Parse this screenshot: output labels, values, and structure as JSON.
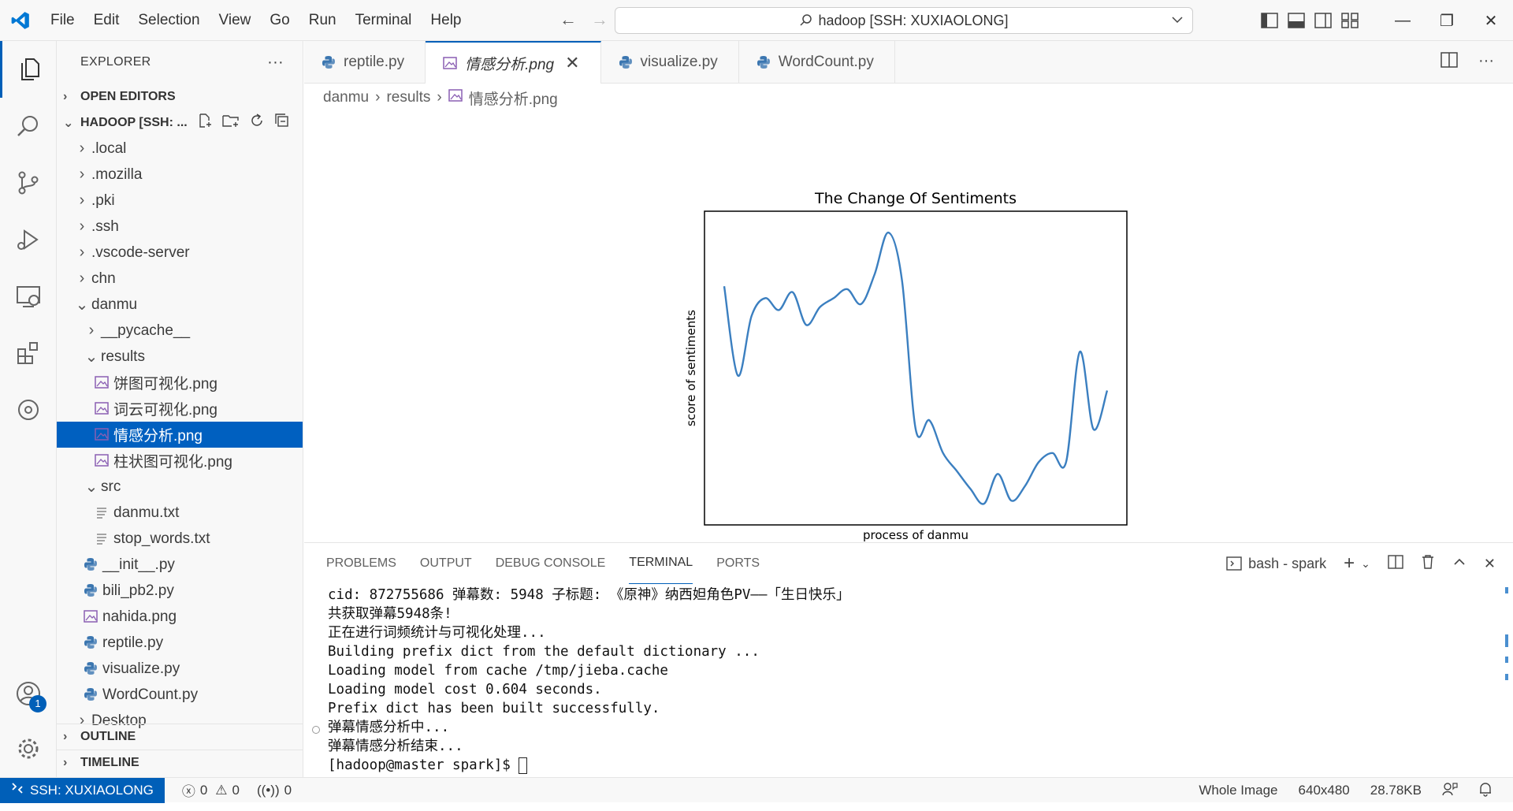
{
  "menu": [
    "File",
    "Edit",
    "Selection",
    "View",
    "Go",
    "Run",
    "Terminal",
    "Help"
  ],
  "command_center": "hadoop [SSH: XUXIAOLONG]",
  "explorer": {
    "title": "EXPLORER",
    "open_editors": "OPEN EDITORS",
    "workspace": "HADOOP [SSH: ...",
    "tree": [
      {
        "label": ".local",
        "depth": 1,
        "type": "folder",
        "open": false
      },
      {
        "label": ".mozilla",
        "depth": 1,
        "type": "folder",
        "open": false
      },
      {
        "label": ".pki",
        "depth": 1,
        "type": "folder",
        "open": false
      },
      {
        "label": ".ssh",
        "depth": 1,
        "type": "folder",
        "open": false
      },
      {
        "label": ".vscode-server",
        "depth": 1,
        "type": "folder",
        "open": false
      },
      {
        "label": "chn",
        "depth": 1,
        "type": "folder",
        "open": false
      },
      {
        "label": "danmu",
        "depth": 1,
        "type": "folder",
        "open": true
      },
      {
        "label": "__pycache__",
        "depth": 2,
        "type": "folder",
        "open": false
      },
      {
        "label": "results",
        "depth": 2,
        "type": "folder",
        "open": true
      },
      {
        "label": "饼图可视化.png",
        "depth": 3,
        "type": "image"
      },
      {
        "label": "词云可视化.png",
        "depth": 3,
        "type": "image"
      },
      {
        "label": "情感分析.png",
        "depth": 3,
        "type": "image",
        "selected": true
      },
      {
        "label": "柱状图可视化.png",
        "depth": 3,
        "type": "image"
      },
      {
        "label": "src",
        "depth": 2,
        "type": "folder",
        "open": true
      },
      {
        "label": "danmu.txt",
        "depth": 3,
        "type": "text"
      },
      {
        "label": "stop_words.txt",
        "depth": 3,
        "type": "text"
      },
      {
        "label": "__init__.py",
        "depth": 2,
        "type": "python"
      },
      {
        "label": "bili_pb2.py",
        "depth": 2,
        "type": "python"
      },
      {
        "label": "nahida.png",
        "depth": 2,
        "type": "image"
      },
      {
        "label": "reptile.py",
        "depth": 2,
        "type": "python"
      },
      {
        "label": "visualize.py",
        "depth": 2,
        "type": "python"
      },
      {
        "label": "WordCount.py",
        "depth": 2,
        "type": "python"
      },
      {
        "label": "Desktop",
        "depth": 1,
        "type": "folder",
        "open": false
      }
    ],
    "outline": "OUTLINE",
    "timeline": "TIMELINE"
  },
  "tabs": [
    {
      "label": "reptile.py",
      "type": "python",
      "active": false
    },
    {
      "label": "情感分析.png",
      "type": "image",
      "active": true
    },
    {
      "label": "visualize.py",
      "type": "python",
      "active": false
    },
    {
      "label": "WordCount.py",
      "type": "python",
      "active": false
    }
  ],
  "breadcrumb": [
    "danmu",
    "results",
    "情感分析.png"
  ],
  "chart_data": {
    "type": "line",
    "title": "The Change Of Sentiments",
    "xlabel": "process of danmu",
    "ylabel": "score of sentiments",
    "grid": false,
    "ticks": false,
    "series": [
      {
        "values": [
          0.78,
          0.48,
          0.68,
          0.74,
          0.7,
          0.76,
          0.65,
          0.71,
          0.74,
          0.77,
          0.72,
          0.82,
          0.96,
          0.8,
          0.3,
          0.33,
          0.22,
          0.16,
          0.1,
          0.05,
          0.15,
          0.06,
          0.11,
          0.19,
          0.22,
          0.19,
          0.56,
          0.3,
          0.43
        ]
      }
    ],
    "color": "#3b7fc0"
  },
  "panel": {
    "tabs": [
      "PROBLEMS",
      "OUTPUT",
      "DEBUG CONSOLE",
      "TERMINAL",
      "PORTS"
    ],
    "active_tab": "TERMINAL",
    "terminal_name": "bash - spark",
    "lines": [
      "cid: 872755686 弹幕数: 5948 子标题: 《原神》纳西妲角色PV——「生日快乐」",
      "共获取弹幕5948条!",
      "正在进行词频统计与可视化处理...",
      "Building prefix dict from the default dictionary ...",
      "Loading model from cache /tmp/jieba.cache",
      "Loading model cost 0.604 seconds.",
      "Prefix dict has been built successfully.",
      "弹幕情感分析中...",
      "弹幕情感分析结束..."
    ],
    "prompt": "[hadoop@master spark]$ "
  },
  "status": {
    "remote": "SSH: XUXIAOLONG",
    "errors": "0",
    "warnings": "0",
    "ports": "0",
    "view_mode": "Whole Image",
    "dimensions": "640x480",
    "size": "28.78KB"
  },
  "colors": {
    "accent": "#005fb8",
    "selection": "#0060c0",
    "python_icon": "#3b76b0",
    "image_icon": "#8a5fb3"
  }
}
